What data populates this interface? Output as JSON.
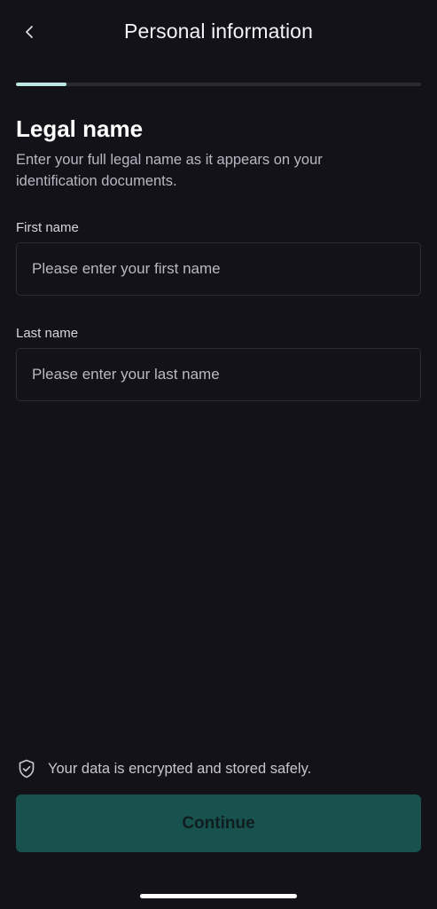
{
  "header": {
    "title": "Personal information",
    "back_icon": "chevron-left-icon"
  },
  "progress": {
    "value": 0.125,
    "fill_color": "#bfe8e4",
    "track_color": "#2a2a33"
  },
  "section": {
    "title": "Legal name",
    "description": "Enter your full legal name as it appears on your identification documents."
  },
  "form": {
    "first_name": {
      "label": "First name",
      "placeholder": "Please enter your first name",
      "value": ""
    },
    "last_name": {
      "label": "Last name",
      "placeholder": "Please enter your last name",
      "value": ""
    }
  },
  "footer": {
    "security_text": "Your data is encrypted and stored safely.",
    "security_icon": "shield-check-icon",
    "continue_label": "Continue"
  },
  "colors": {
    "background": "#131218",
    "accent": "#17524f",
    "text": "#ffffff"
  }
}
